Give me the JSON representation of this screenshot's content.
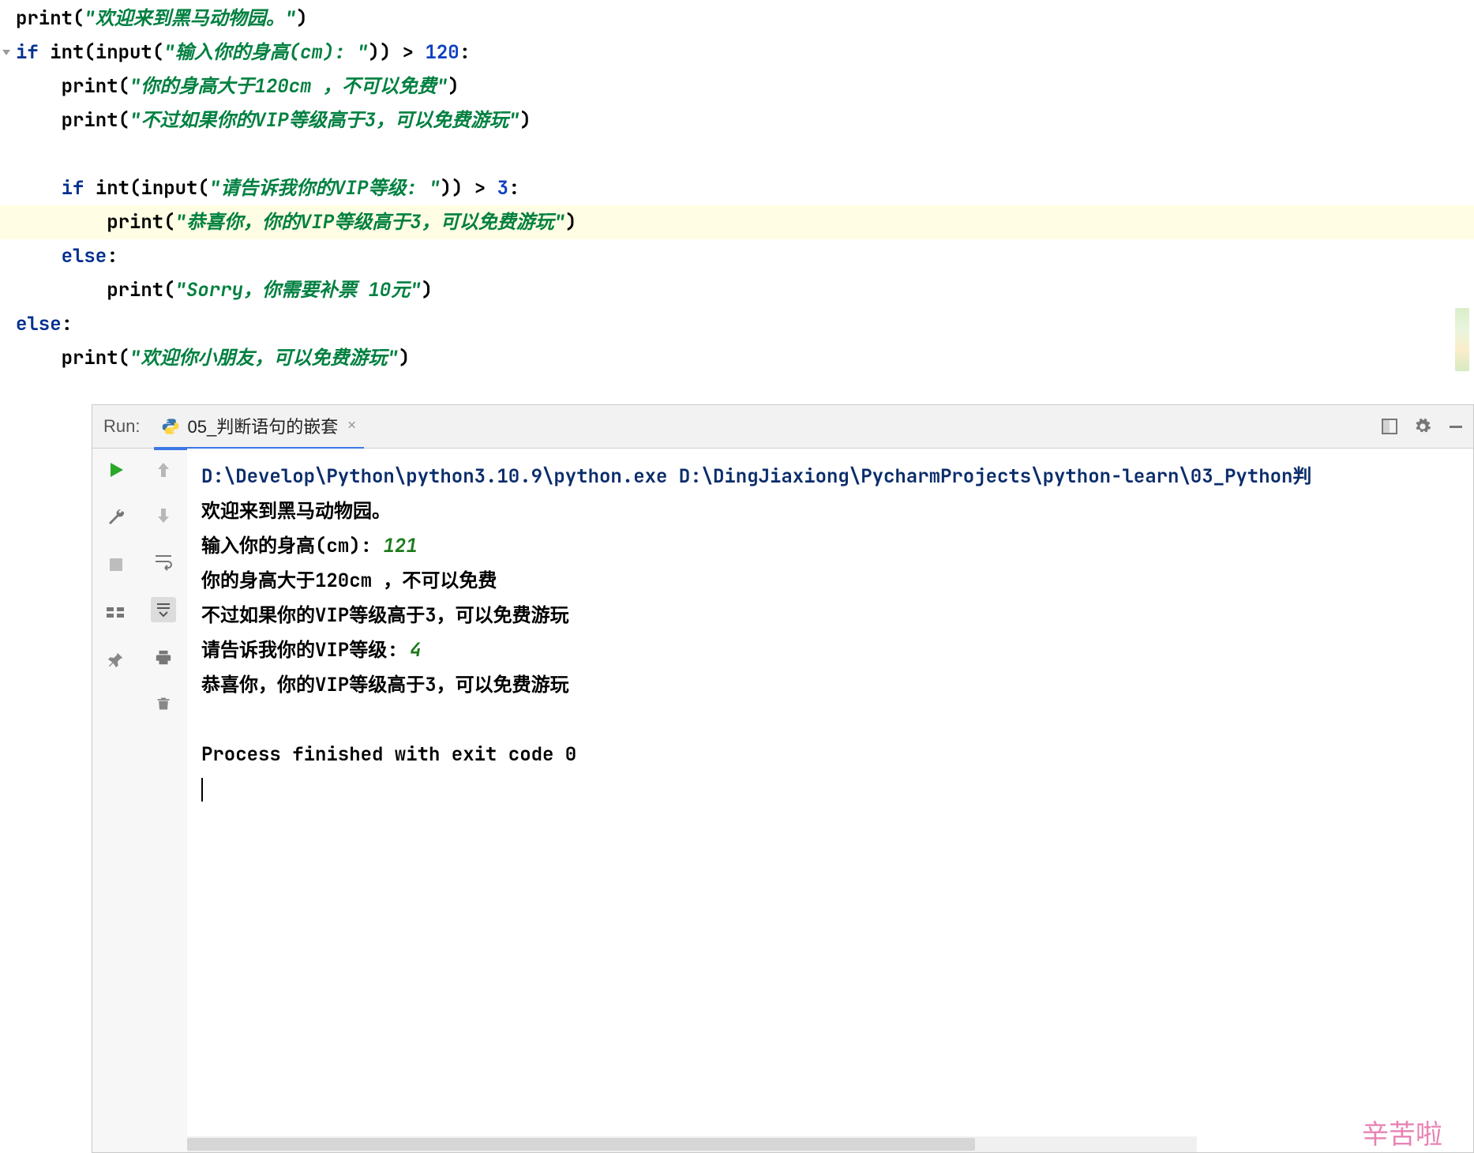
{
  "code": {
    "l1_fn": "print",
    "l1_str": "\"欢迎来到黑马动物园。\"",
    "l2_kw1": "if ",
    "l2_fn1": "int",
    "l2_fn2": "input",
    "l2_str": "\"输入你的身高(cm): \"",
    "l2_op": " > ",
    "l2_num": "120",
    "l2_colon": ":",
    "l3_fn": "print",
    "l3_str": "\"你的身高大于120cm ，不可以免费\"",
    "l4_fn": "print",
    "l4_str": "\"不过如果你的VIP等级高于3，可以免费游玩\"",
    "l6_kw": "if ",
    "l6_fn1": "int",
    "l6_fn2": "input",
    "l6_str": "\"请告诉我你的VIP等级: \"",
    "l6_op": " > ",
    "l6_num": "3",
    "l6_colon": ":",
    "l7_fn": "print",
    "l7_str": "\"恭喜你，你的VIP等级高于3，可以免费游玩\"",
    "l8_kw": "else",
    "l8_colon": ":",
    "l9_fn": "print",
    "l9_str": "\"Sorry，你需要补票 10元\"",
    "l10_kw": "else",
    "l10_colon": ":",
    "l11_fn": "print",
    "l11_str": "\"欢迎你小朋友，可以免费游玩\""
  },
  "run": {
    "label": "Run:",
    "tab_name": "05_判断语句的嵌套",
    "console": {
      "path": "D:\\Develop\\Python\\python3.10.9\\python.exe D:\\DingJiaxiong\\PycharmProjects\\python-learn\\03_Python判",
      "out1": "欢迎来到黑马动物园。",
      "prompt1": "输入你的身高(cm): ",
      "inp1": "121",
      "out2": "你的身高大于120cm ，不可以免费",
      "out3": "不过如果你的VIP等级高于3，可以免费游玩",
      "prompt2": "请告诉我你的VIP等级: ",
      "inp2": "4",
      "out4": "恭喜你，你的VIP等级高于3，可以免费游玩",
      "exit": "Process finished with exit code 0"
    }
  },
  "watermark": "辛苦啦"
}
